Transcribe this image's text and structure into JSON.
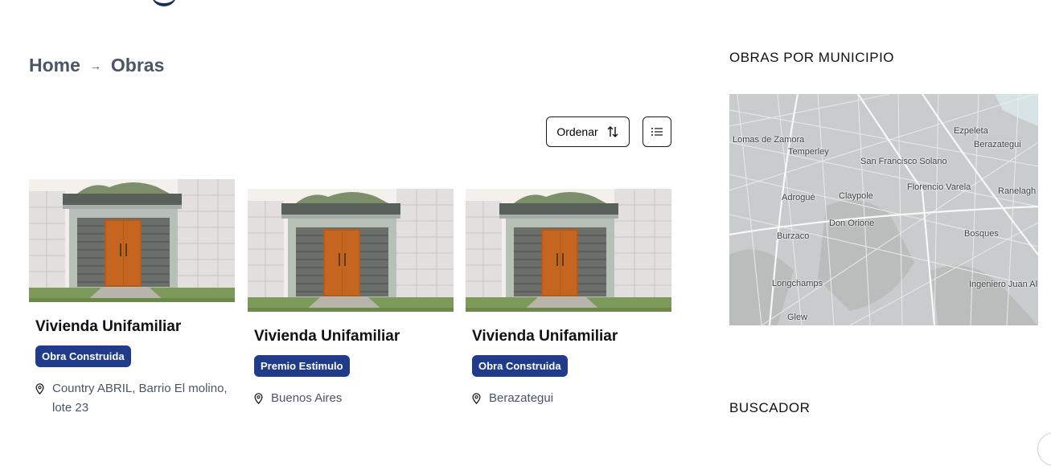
{
  "breadcrumb": {
    "home": "Home",
    "separator": "→",
    "current": "Obras"
  },
  "toolbar": {
    "ordenar_label": "Ordenar",
    "sort_icon": "sort-arrows-icon",
    "list_icon": "list-view-icon"
  },
  "cards": [
    {
      "title": "Vivienda Unifamiliar",
      "badge": "Obra Construida",
      "location": "Country ABRIL, Barrio El molino, lote 23"
    },
    {
      "title": "Vivienda Unifamiliar",
      "badge": "Premio Estimulo",
      "location": "Buenos Aires"
    },
    {
      "title": "Vivienda Unifamiliar",
      "badge": "Obra Construida",
      "location": "Berazategui"
    }
  ],
  "sidebar": {
    "map_title": "OBRAS POR MUNICIPIO",
    "search_title": "BUSCADOR",
    "map_labels": [
      "Lomas de Zamora",
      "Temperley",
      "San Francisco Solano",
      "Ezpeleta",
      "Berazategui",
      "Adrogué",
      "Claypole",
      "Florencio Varela",
      "Ranelagh",
      "Don Orione",
      "Burzaco",
      "Bosques",
      "Longchamps",
      "Ingeniero Juan Allan",
      "Glew"
    ]
  },
  "colors": {
    "badge": "#1f3b8a",
    "text_muted": "#4a5566",
    "map_bg": "#c8cbcb"
  }
}
